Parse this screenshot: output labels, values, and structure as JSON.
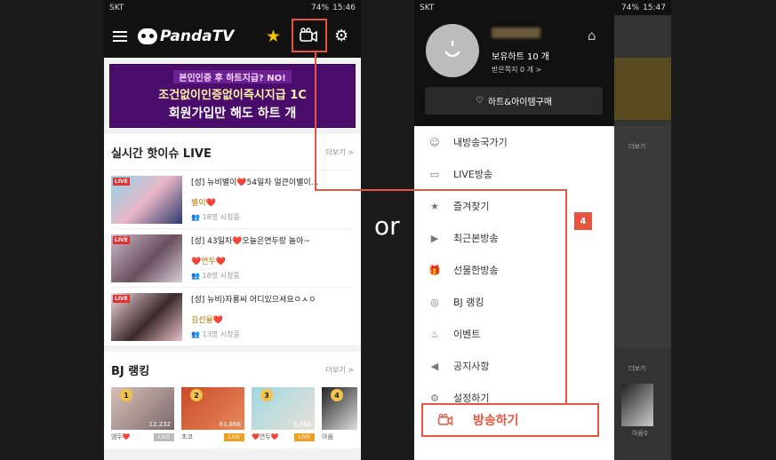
{
  "left": {
    "status": {
      "carrier": "SKT",
      "battery": "74%",
      "time": "15:46"
    },
    "app_title": "PandaTV",
    "banner": {
      "line1": "본인인증 후 하트지급? NO!",
      "line2": "조건없이인증없이즉시지급 1C",
      "line3": "회원가입만 해도 하트 개"
    },
    "live_section": {
      "title": "실시간 핫이슈 LIVE",
      "more": "더보기 >",
      "live_tag": "LIVE",
      "items": [
        {
          "title": "[성] 뉴비별이❤️54일차 얼큰이별이...",
          "bj": "별이❤️",
          "viewers": "18명 시청중"
        },
        {
          "title": "[성] 43일차❤️오늘은연두랑 놀아~",
          "bj": "❤️연두❤️",
          "viewers": "18명 시청중"
        },
        {
          "title": "[성] 뉴비)자룡씨 어디있으셔요ㅇㅅㅇ",
          "bj": "김선율❤️",
          "viewers": "13명 시청중"
        }
      ]
    },
    "rank_section": {
      "title": "BJ 랭킹",
      "more": "더보기 >",
      "items": [
        {
          "rank": "1",
          "count": "12,232",
          "name": "엠두❤️",
          "label": "LIVE",
          "color": "#bbbbbb"
        },
        {
          "rank": "2",
          "count": "61,866",
          "name": "초코",
          "label": "LIVE",
          "color": "#f0a020"
        },
        {
          "rank": "3",
          "count": "8,066",
          "name": "❤️연두❤️",
          "label": "LIVE",
          "color": "#f0a020"
        },
        {
          "rank": "4",
          "count": "",
          "name": "아윰",
          "label": "",
          "color": "#bbbbbb"
        }
      ]
    }
  },
  "or_label": "or",
  "step_badge": "4",
  "right": {
    "status": {
      "carrier": "SKT",
      "battery": "74%",
      "time": "15:47"
    },
    "hearts": "보유하트 10 개",
    "notes": "받은쪽지 0 개 >",
    "buy_button": "하트&아이템구매",
    "menu": [
      {
        "label": "내방송국가기",
        "icon": "person-icon"
      },
      {
        "label": "LIVE방송",
        "icon": "live-icon"
      },
      {
        "label": "즐겨찾기",
        "icon": "star-icon"
      },
      {
        "label": "최근본방송",
        "icon": "play-icon"
      },
      {
        "label": "선물한방송",
        "icon": "gift-icon"
      },
      {
        "label": "BJ 랭킹",
        "icon": "medal-icon"
      },
      {
        "label": "이벤트",
        "icon": "cake-icon"
      },
      {
        "label": "공지사항",
        "icon": "megaphone-icon"
      },
      {
        "label": "설정하기",
        "icon": "gear-icon"
      }
    ],
    "broadcast_button": "방송하기",
    "peek": {
      "more": "더보기",
      "rank_label": "4",
      "rank_name": "아윰♀"
    }
  }
}
